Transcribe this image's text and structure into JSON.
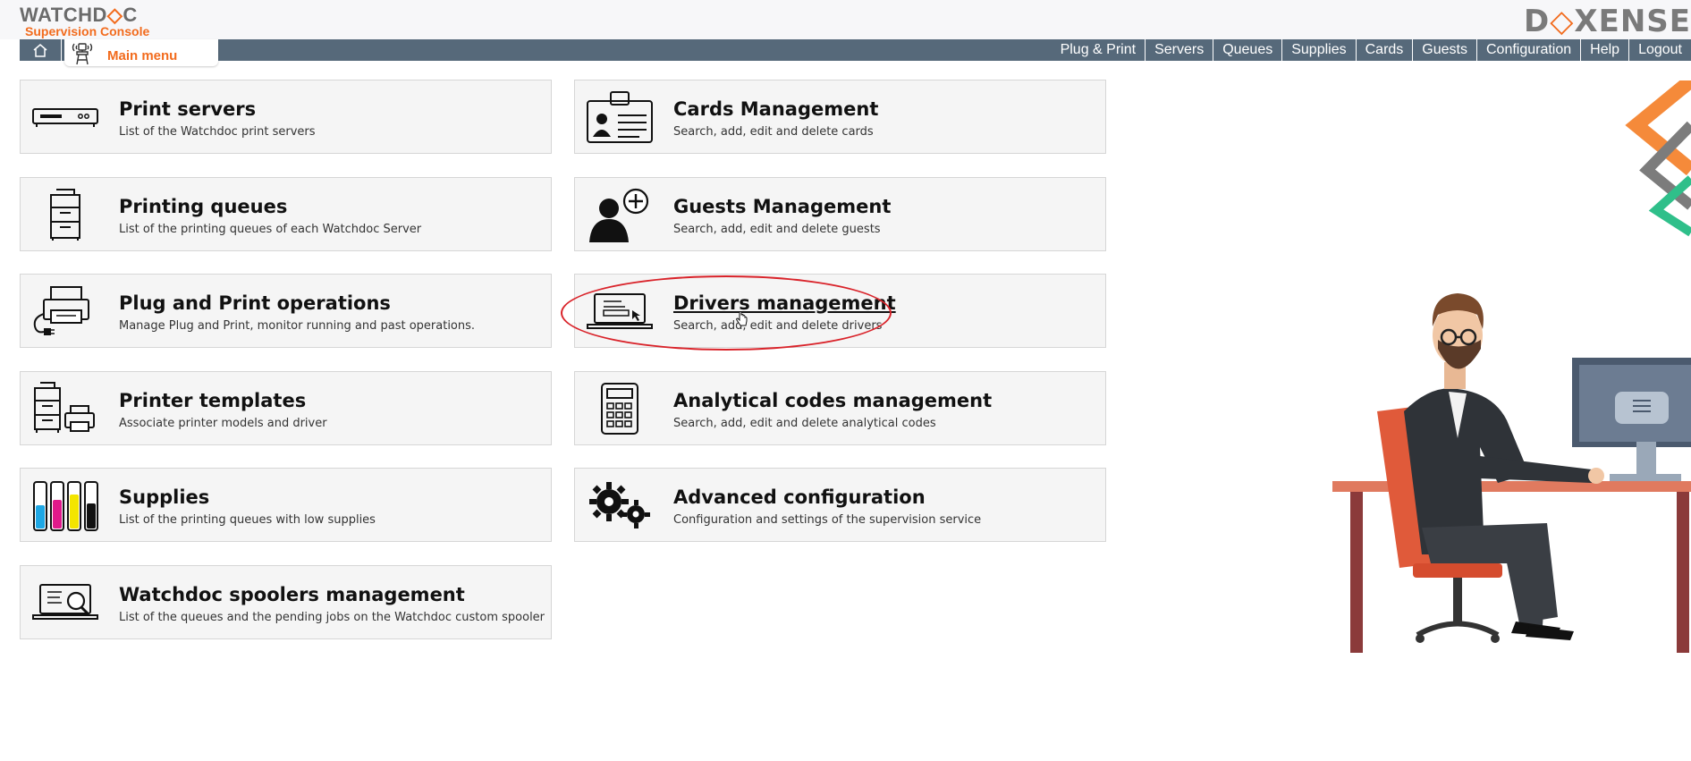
{
  "header": {
    "logo_brand_part1": "WATCHD",
    "logo_brand_x": "◇",
    "logo_brand_part2": "C",
    "logo_subtitle": "Supervision Console",
    "company_part1": "D",
    "company_x": "◇",
    "company_part2": "XENSE"
  },
  "nav": {
    "main_menu_label": "Main menu",
    "items": [
      "Plug & Print",
      "Servers",
      "Queues",
      "Supplies",
      "Cards",
      "Guests",
      "Configuration",
      "Help",
      "Logout"
    ]
  },
  "tiles": [
    {
      "title": "Print servers",
      "desc": "List of the Watchdoc print servers",
      "icon": "print-server-icon"
    },
    {
      "title": "Cards Management",
      "desc": "Search, add, edit and delete cards",
      "icon": "id-card-icon"
    },
    {
      "title": "Printing queues",
      "desc": "List of the printing queues of each Watchdoc Server",
      "icon": "printer-stack-icon"
    },
    {
      "title": "Guests Management",
      "desc": "Search, add, edit and delete guests",
      "icon": "add-guest-icon"
    },
    {
      "title": "Plug and Print operations",
      "desc": "Manage Plug and Print, monitor running and past operations.",
      "icon": "plug-printer-icon"
    },
    {
      "title": "Drivers management",
      "desc": "Search, add, edit and delete drivers",
      "icon": "laptop-icon"
    },
    {
      "title": "Printer templates",
      "desc": "Associate printer models and driver",
      "icon": "printer-template-icon"
    },
    {
      "title": "Analytical codes management",
      "desc": "Search, add, edit and delete analytical codes",
      "icon": "calculator-icon"
    },
    {
      "title": "Supplies",
      "desc": "List of the printing queues with low supplies",
      "icon": "ink-cartridges-icon"
    },
    {
      "title": "Advanced configuration",
      "desc": "Configuration and settings of the supervision service",
      "icon": "gears-icon"
    },
    {
      "title": "Watchdoc spoolers management",
      "desc": "List of the queues and the pending jobs on the Watchdoc custom spooler",
      "icon": "laptop-search-icon"
    }
  ],
  "colors": {
    "brand_orange": "#f26b1d",
    "navbar": "#56697a",
    "highlight_red": "#d9232a"
  }
}
